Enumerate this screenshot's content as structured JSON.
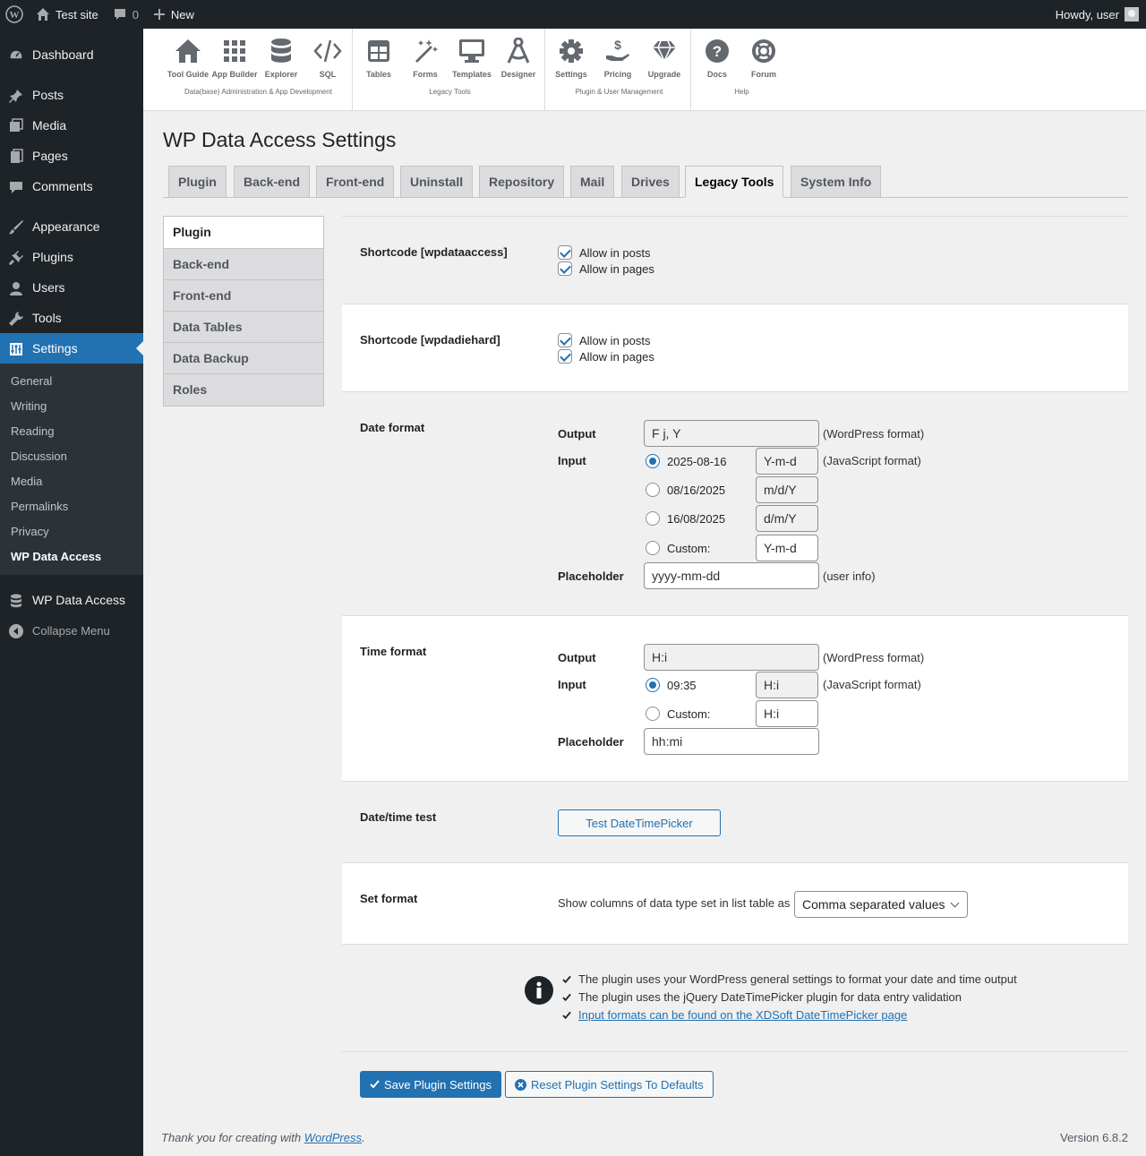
{
  "adminbar": {
    "site_name": "Test site",
    "comments_count": "0",
    "new_label": "New",
    "howdy": "Howdy, user"
  },
  "sidebar": {
    "items": [
      {
        "label": "Dashboard",
        "icon": "dashboard-icon"
      },
      {
        "label": "Posts",
        "icon": "pin-icon"
      },
      {
        "label": "Media",
        "icon": "media-icon"
      },
      {
        "label": "Pages",
        "icon": "pages-icon"
      },
      {
        "label": "Comments",
        "icon": "comment-icon"
      },
      {
        "label": "Appearance",
        "icon": "brush-icon"
      },
      {
        "label": "Plugins",
        "icon": "plugin-icon"
      },
      {
        "label": "Users",
        "icon": "user-icon"
      },
      {
        "label": "Tools",
        "icon": "wrench-icon"
      },
      {
        "label": "Settings",
        "icon": "settings-sliders-icon"
      }
    ],
    "submenu": [
      "General",
      "Writing",
      "Reading",
      "Discussion",
      "Media",
      "Permalinks",
      "Privacy",
      "WP Data Access"
    ],
    "wpda_label": "WP Data Access",
    "collapse_label": "Collapse Menu"
  },
  "toolbar": {
    "groups": [
      {
        "title": "Data(base) Administration & App Development",
        "buttons": [
          "Tool Guide",
          "App Builder",
          "Explorer",
          "SQL"
        ]
      },
      {
        "title": "Legacy Tools",
        "buttons": [
          "Tables",
          "Forms",
          "Templates",
          "Designer"
        ]
      },
      {
        "title": "Plugin & User Management",
        "buttons": [
          "Settings",
          "Pricing",
          "Upgrade"
        ]
      },
      {
        "title": "Help",
        "buttons": [
          "Docs",
          "Forum"
        ]
      }
    ]
  },
  "page_title": "WP Data Access Settings",
  "tabs": [
    "Plugin",
    "Back-end",
    "Front-end",
    "Uninstall",
    "Repository",
    "Mail",
    "Drives",
    "Legacy Tools",
    "System Info"
  ],
  "active_tab": "Legacy Tools",
  "subtabs": [
    "Plugin",
    "Back-end",
    "Front-end",
    "Data Tables",
    "Data Backup",
    "Roles"
  ],
  "active_subtab": "Plugin",
  "shortcode1": {
    "label": "Shortcode [wpdataaccess]",
    "allow_posts": "Allow in posts",
    "allow_pages": "Allow in pages",
    "posts_checked": true,
    "pages_checked": true
  },
  "shortcode2": {
    "label": "Shortcode [wpdadiehard]",
    "allow_posts": "Allow in posts",
    "allow_pages": "Allow in pages",
    "posts_checked": true,
    "pages_checked": true
  },
  "date_format": {
    "label": "Date format",
    "output_label": "Output",
    "output_value": "F j, Y",
    "output_note": "(WordPress format)",
    "input_label": "Input",
    "input_note": "(JavaScript format)",
    "options": [
      {
        "label": "2025-08-16",
        "format": "Y-m-d",
        "checked": true
      },
      {
        "label": "08/16/2025",
        "format": "m/d/Y",
        "checked": false
      },
      {
        "label": "16/08/2025",
        "format": "d/m/Y",
        "checked": false
      },
      {
        "label": "Custom:",
        "format": "Y-m-d",
        "checked": false
      }
    ],
    "placeholder_label": "Placeholder",
    "placeholder_value": "yyyy-mm-dd",
    "placeholder_note": "(user info)"
  },
  "time_format": {
    "label": "Time format",
    "output_label": "Output",
    "output_value": "H:i",
    "output_note": "(WordPress format)",
    "input_label": "Input",
    "input_note": "(JavaScript format)",
    "options": [
      {
        "label": "09:35",
        "format": "H:i",
        "checked": true
      },
      {
        "label": "Custom:",
        "format": "H:i",
        "checked": false
      }
    ],
    "placeholder_label": "Placeholder",
    "placeholder_value": "hh:mi"
  },
  "datetime_test": {
    "label": "Date/time test",
    "button": "Test DateTimePicker"
  },
  "set_format": {
    "label": "Set format",
    "text": "Show columns of data type set in list table as",
    "selected": "Comma separated values"
  },
  "info": {
    "lines": [
      "The plugin uses your WordPress general settings to format your date and time output",
      "The plugin uses the jQuery DateTimePicker plugin for data entry validation",
      "Input formats can be found on the XDSoft DateTimePicker page"
    ]
  },
  "buttons": {
    "save": "Save Plugin Settings",
    "reset": "Reset Plugin Settings To Defaults"
  },
  "footer": {
    "thanks_prefix": "Thank you for creating with",
    "wordpress_link": "WordPress",
    "thanks_suffix": ".",
    "version": "Version 6.8.2"
  },
  "colors": {
    "accent": "#2271b1",
    "sidebar_bg": "#1d2327",
    "page_bg": "#f0f0f1"
  }
}
